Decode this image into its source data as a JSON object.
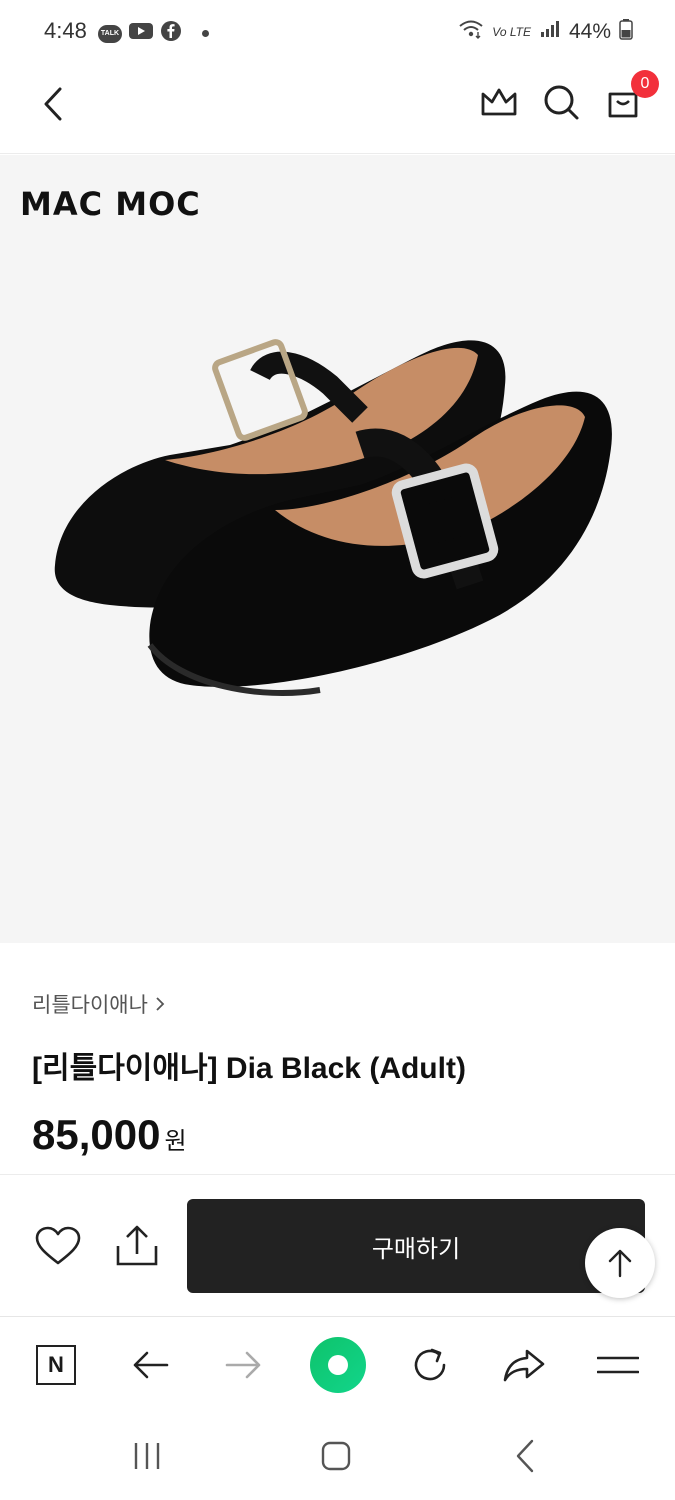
{
  "status_bar": {
    "time": "4:48",
    "talk_label": "TALK",
    "network": "Vo LTE",
    "battery": "44%"
  },
  "header": {
    "cart_count": "0"
  },
  "product": {
    "brand_logo": "MAC MOC",
    "breadcrumb": "리틀다이애나",
    "title": "[리틀다이애나] Dia Black (Adult)",
    "price": "85,000",
    "currency": "원"
  },
  "actions": {
    "buy_label": "구매하기"
  },
  "browser_toolbar": {
    "home_label": "N"
  },
  "colors": {
    "buy_button": "#222222",
    "badge": "#f2303b",
    "naver_green": "#0ec36b"
  }
}
